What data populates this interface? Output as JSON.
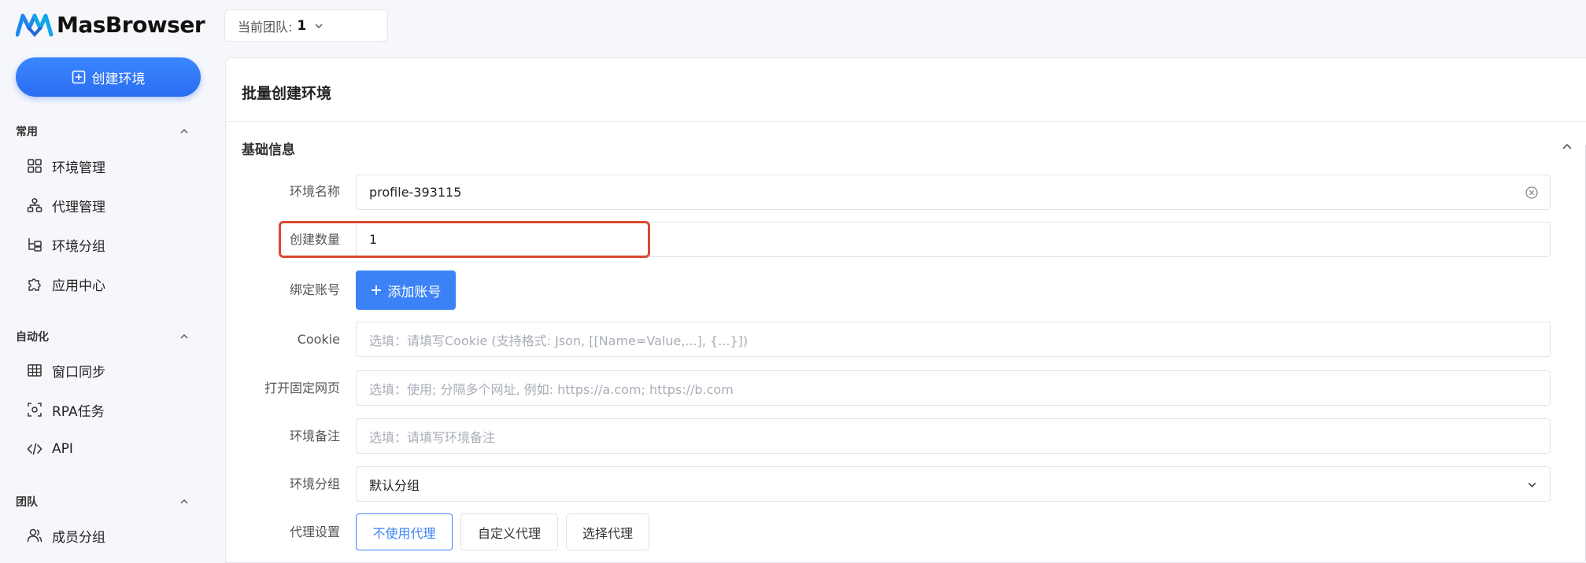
{
  "app": {
    "name": "MasBrowser"
  },
  "sidebar": {
    "create_button": "创建环境",
    "sections": [
      {
        "title": "常用",
        "items": [
          "环境管理",
          "代理管理",
          "环境分组",
          "应用中心"
        ]
      },
      {
        "title": "自动化",
        "items": [
          "窗口同步",
          "RPA任务",
          "API"
        ]
      },
      {
        "title": "团队",
        "items": [
          "成员分组"
        ]
      }
    ]
  },
  "team": {
    "label": "当前团队:",
    "value": "1"
  },
  "panel": {
    "title": "批量创建环境",
    "section_title": "基础信息",
    "fields": {
      "name": {
        "label": "环境名称",
        "value": "profile-393115"
      },
      "count": {
        "label": "创建数量",
        "value": "1"
      },
      "account": {
        "label": "绑定账号",
        "button": "添加账号"
      },
      "cookie": {
        "label": "Cookie",
        "placeholder": "选填：请填写Cookie (支持格式: Json, [[Name=Value,...], {...}])"
      },
      "urls": {
        "label": "打开固定网页",
        "placeholder": "选填：使用; 分隔多个网址, 例如: https://a.com; https://b.com"
      },
      "note": {
        "label": "环境备注",
        "placeholder": "选填：请填写环境备注"
      },
      "group": {
        "label": "环境分组",
        "value": "默认分组"
      },
      "proxy": {
        "label": "代理设置",
        "options": [
          "不使用代理",
          "自定义代理",
          "选择代理"
        ],
        "selected": "不使用代理"
      }
    }
  },
  "colors": {
    "primary": "#3b82f6",
    "highlight": "#d84a32"
  }
}
